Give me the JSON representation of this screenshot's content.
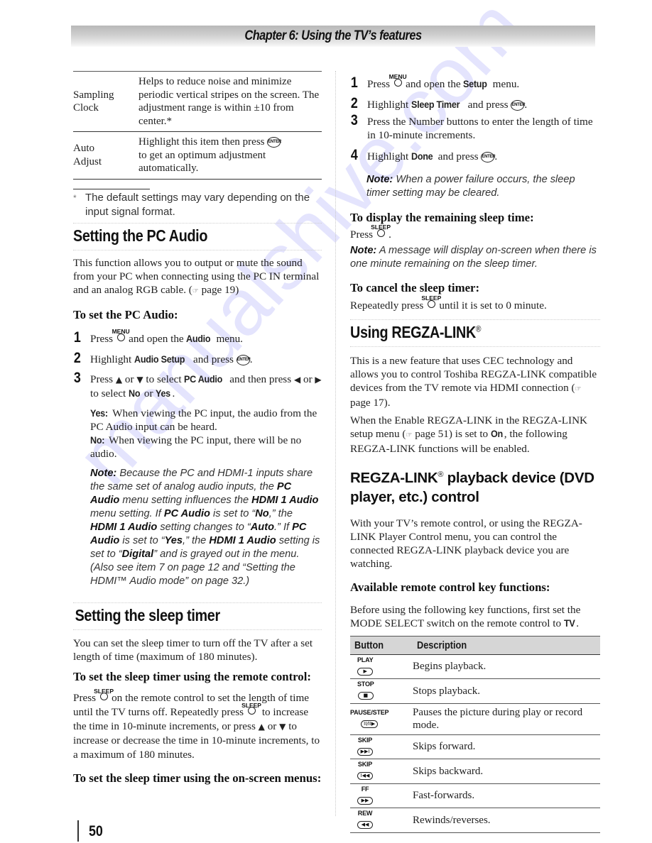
{
  "header": {
    "chapter_title": "Chapter 6: Using the TV’s features"
  },
  "settings_table": {
    "rows": [
      {
        "name": [
          "Sampling",
          "Clock"
        ],
        "description": "Helps to reduce noise and minimize periodic vertical stripes on the screen. The adjustment range is within ±10 from center.*"
      },
      {
        "name": [
          "Auto",
          "Adjust"
        ],
        "description_before": "Highlight this item then press",
        "description_after": "to get an optimum adjustment automatically."
      }
    ]
  },
  "footnote": {
    "marker": "*",
    "text": "The default settings may vary depending on the input signal format."
  },
  "pc_audio": {
    "heading": "Setting the PC Audio",
    "intro": "This function allows you to output or mute the sound from your PC when connecting using the PC IN terminal and an analog RGB cable. (",
    "intro_ref": "page 19)",
    "subheading": "To set the PC Audio:",
    "steps": [
      {
        "num": "1",
        "a": "Press",
        "key": "MENU",
        "b": "and open the",
        "bold": "Audio",
        "c": "menu."
      },
      {
        "num": "2",
        "a": "Highlight",
        "bold": "Audio Setup",
        "b": "and press"
      },
      {
        "num": "3",
        "a": "Press",
        "b": "or",
        "c": "to select",
        "bold": "PC Audio",
        "d": "and then press",
        "e": "or",
        "f": "to select",
        "bold2": "No",
        "g": "or",
        "bold3": "Yes",
        "h": "."
      }
    ],
    "yes_label": "Yes:",
    "yes_text": "When viewing the PC input, the audio from the PC Audio input can be heard.",
    "no_label": "No:",
    "no_text": "When viewing the PC input, there will be no audio.",
    "note": {
      "label": "Note:",
      "p1": "Because the PC and HDMI-1 inputs share the same set of analog audio inputs, the",
      "b1": "PC Audio",
      "p2": "menu setting influences the",
      "b2": "HDMI 1 Audio",
      "p3": "menu setting. If",
      "b3": "PC Audio",
      "p4": "is set to “",
      "b4": "No",
      "p5": ",” the",
      "b5": "HDMI 1 Audio",
      "p6": "setting changes to “",
      "b6": "Auto",
      "p7": ".” If",
      "b7": "PC Audio",
      "p8": "is set to “",
      "b8": "Yes",
      "p9": ",” the",
      "b9": "HDMI 1 Audio",
      "p10": "setting is set to “",
      "b10": "Digital",
      "p11": "” and is grayed out in the menu. (Also see item 7 on page 12 and “Setting the HDMI™ Audio mode” on page 32.)"
    }
  },
  "sleep_timer": {
    "heading": "Setting the sleep timer",
    "intro": "You can set the sleep timer to turn off the TV after a set length of time (maximum of 180 minutes).",
    "remote_heading": "To set the sleep timer using the remote control:",
    "remote_p1": "Press",
    "remote_p2": "on the remote control to set the length of time until the TV turns off. Repeatedly press",
    "remote_p3": "to increase the time in 10-minute increments, or press",
    "remote_p4": "or",
    "remote_p5": "to increase or decrease the time in 10-minute increments, to a maximum of 180 minutes.",
    "menus_heading": "To set the sleep timer using the on-screen menus:",
    "steps": [
      {
        "num": "1",
        "a": "Press",
        "key": "MENU",
        "b": "and open the",
        "bold": "Setup",
        "c": "menu."
      },
      {
        "num": "2",
        "a": "Highlight",
        "bold": "Sleep Timer",
        "b": "and press"
      },
      {
        "num": "3",
        "a": "Press the Number buttons to enter the length of time in 10-minute increments."
      },
      {
        "num": "4",
        "a": "Highlight",
        "bold": "Done",
        "b": "and press"
      }
    ],
    "note1_label": "Note:",
    "note1_text": "When a power failure occurs, the sleep timer setting may be cleared.",
    "display_heading": "To display the remaining sleep time:",
    "display_press": "Press",
    "note2_label": "Note:",
    "note2_text": "A message will display on-screen when there is one minute remaining on the sleep timer.",
    "cancel_heading": "To cancel the sleep timer:",
    "cancel_p1": "Repeatedly press",
    "cancel_p2": "until it is set to 0 minute.",
    "key_label": "SLEEP"
  },
  "regza": {
    "heading": "Using REGZA-LINK",
    "reg_mark": "®",
    "p1": "This is a new feature that uses CEC technology and allows you to control Toshiba REGZA-LINK compatible devices from the TV remote via HDMI connection (",
    "p1_ref": "page 17).",
    "p2a": "When the Enable REGZA-LINK in the REGZA-LINK setup menu (",
    "p2_ref": "page 51) is set to",
    "p2_bold": "On",
    "p2b": ", the following REGZA-LINK functions will be enabled.",
    "playback_heading_a": "REGZA-LINK",
    "playback_heading_b": "playback device (DVD player, etc.) control",
    "playback_p": "With your TV’s remote control, or using the REGZA-LINK Player Control menu, you can control the connected REGZA-LINK playback device you are watching.",
    "keys_heading": "Available remote control key functions:",
    "keys_intro": "Before using the following key functions, first set the MODE SELECT switch on the remote control to",
    "keys_intro_bold": "TV",
    "table": {
      "headers": [
        "Button",
        "Description"
      ],
      "rows": [
        {
          "label": "PLAY",
          "glyph": "▶",
          "desc": "Begins playback."
        },
        {
          "label": "STOP",
          "glyph": "■",
          "desc": "Stops playback."
        },
        {
          "label": "PAUSE/STEP",
          "glyph": "II/II▶",
          "desc": "Pauses the picture during play or record mode."
        },
        {
          "label": "SKIP",
          "glyph": "▶▶I",
          "desc": "Skips forward."
        },
        {
          "label": "SKIP",
          "glyph": "I◀◀",
          "desc": "Skips backward."
        },
        {
          "label": "FF",
          "glyph": "▶▶",
          "desc": "Fast-forwards."
        },
        {
          "label": "REW",
          "glyph": "◀◀",
          "desc": "Rewinds/reverses."
        }
      ]
    }
  },
  "icons": {
    "enter": "ENTER",
    "up": "▲",
    "down": "▼",
    "left": "◀",
    "right": "▶",
    "ref": "☞"
  },
  "page_number": "50",
  "watermark": "manualshive.com"
}
